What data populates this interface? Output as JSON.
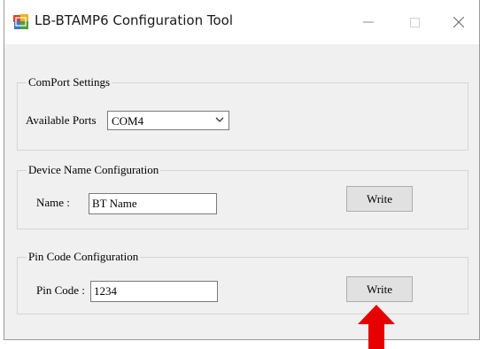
{
  "window": {
    "title": "LB-BTAMP6 Configuration Tool",
    "controls": {
      "minimize": "minimize-icon",
      "maximize": "maximize-icon",
      "close": "close-icon"
    }
  },
  "comport": {
    "legend": "ComPort Settings",
    "ports_label": "Available Ports",
    "selected_port": "COM4"
  },
  "device_name": {
    "legend": "Device Name Configuration",
    "label": "Name :",
    "value": "BT Name",
    "write_label": "Write"
  },
  "pin_code": {
    "legend": "Pin Code Configuration",
    "label": "Pin Code :",
    "value": "1234",
    "write_label": "Write"
  },
  "annotation": {
    "arrow_icon": "red-up-arrow-icon",
    "color": "#e60000"
  },
  "colors": {
    "window_bg": "#f0f0f0",
    "button_bg": "#e1e1e1",
    "group_border": "#d5d5d5"
  }
}
